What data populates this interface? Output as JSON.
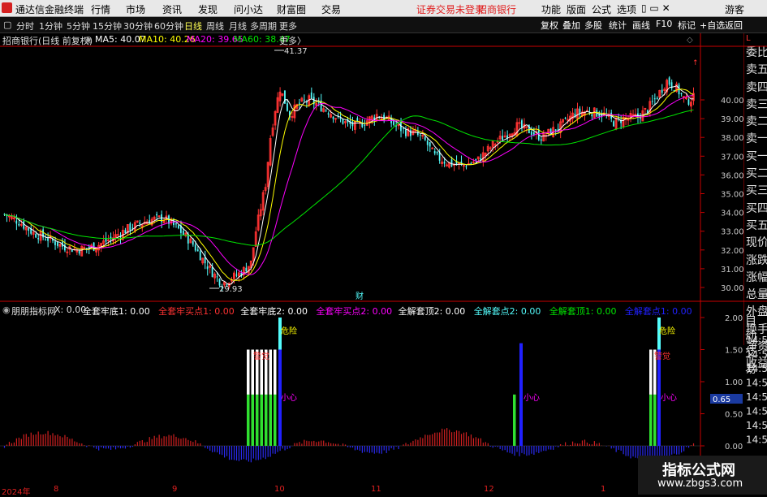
{
  "menubar": {
    "app_title": "通达信金融终端",
    "items": [
      "行情",
      "市场",
      "资讯",
      "发现",
      "问小达",
      "财富圈",
      "交易"
    ],
    "warning": "证券交易未登录",
    "broker": "招商银行",
    "right_items": [
      "功能",
      "版面",
      "公式",
      "选项"
    ],
    "guest": "游客"
  },
  "toolbar": {
    "periods": [
      "分时",
      "1分钟",
      "5分钟",
      "15分钟",
      "30分钟",
      "60分钟",
      "日线",
      "周线",
      "月线",
      "多周期",
      "更多"
    ],
    "selected": "日线",
    "right_items": [
      "复权",
      "叠加",
      "多股",
      "统计",
      "画线",
      "F10",
      "标记",
      "+自选",
      "返回"
    ]
  },
  "info": {
    "stock_title": "招商银行(日线 前复权)",
    "ma5": "MA5: 40.07",
    "ma10": "MA10: 40.26",
    "ma20": "MA20: 39.65",
    "ma60": "MA60: 38.47"
  },
  "colors": {
    "up": "#ff3232",
    "down": "#54fcfc",
    "ma5": "#ffffff",
    "ma10": "#ffff00",
    "ma20": "#ff00ff",
    "ma60": "#00e600",
    "axis": "#c80000"
  },
  "price_axis": [
    "40.00",
    "39.00",
    "38.00",
    "37.00",
    "36.00",
    "35.00",
    "34.00",
    "33.00",
    "32.00",
    "31.00",
    "30.00"
  ],
  "annotations": {
    "high": "41.37",
    "low": "29.93",
    "cai": "财"
  },
  "right_panel": {
    "items": [
      "委比",
      "卖五",
      "卖四",
      "卖三",
      "卖二",
      "卖一",
      "买一",
      "买二",
      "买三",
      "买四",
      "买五",
      "现价",
      "涨跌",
      "涨幅",
      "总量",
      "外盘",
      "换手",
      "净资",
      "收益"
    ],
    "bottom": [
      "自动",
      "交易"
    ],
    "letter_l": "L"
  },
  "indicator": {
    "name": "朋朋指标网",
    "x": "X: 0.00",
    "fields": [
      {
        "text": "全套牢底1: 0.00",
        "color": "#ffffff"
      },
      {
        "text": "全套牢买点1: 0.00",
        "color": "#ff3232"
      },
      {
        "text": "全套牢底2: 0.00",
        "color": "#ffffff"
      },
      {
        "text": "全套牢买点2: 0.00",
        "color": "#ff00ff"
      },
      {
        "text": "全解套顶2: 0.00",
        "color": "#ffffff"
      },
      {
        "text": "全解套点2: 0.00",
        "color": "#54fcfc"
      },
      {
        "text": "全解套顶1: 0.00",
        "color": "#00e600"
      },
      {
        "text": "全解套点1: 0.00",
        "color": "#2020ff"
      }
    ],
    "axis": [
      "2.00",
      "1.50",
      "1.00",
      "0.50",
      "0.00"
    ],
    "current_value": "0.65",
    "right_times": [
      "14:56",
      "14:56",
      "14:56",
      "14:56",
      "14:56",
      "14:56",
      "14:56",
      "14:56"
    ],
    "labels": {
      "danger": "危险",
      "careful": "小心",
      "arrow_label": "警觉"
    }
  },
  "timebar": {
    "labels": [
      "2024年",
      "8",
      "9",
      "10",
      "11",
      "12",
      "1"
    ]
  },
  "watermark": {
    "title": "指标公式网",
    "url": "www.zbgs3.com"
  }
}
